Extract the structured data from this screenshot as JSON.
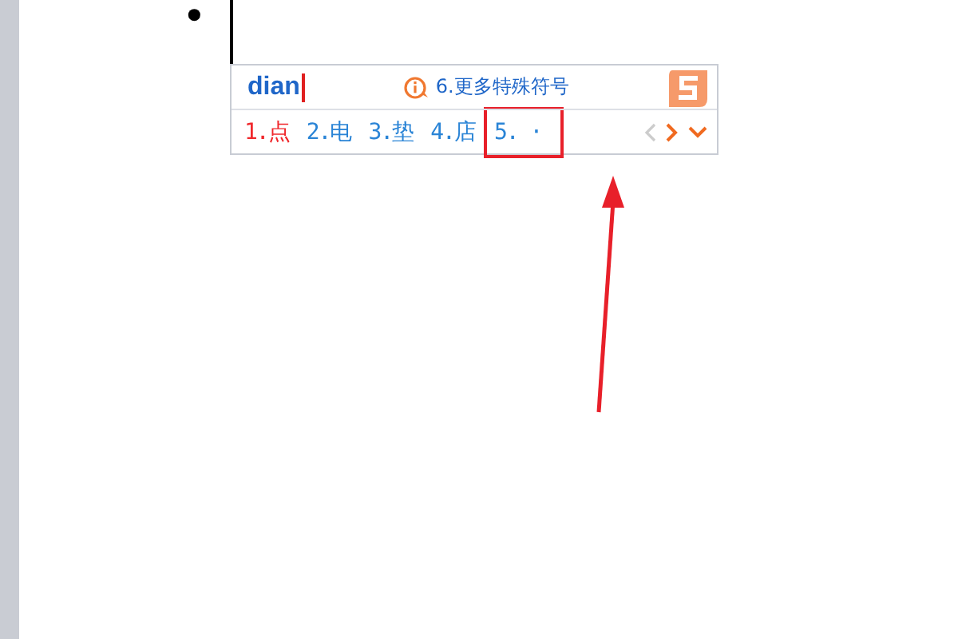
{
  "document": {
    "bullet": "•"
  },
  "ime": {
    "composition": "dian",
    "hint": "6.更多特殊符号",
    "candidates": [
      {
        "label": "1.点",
        "selected": true,
        "highlighted": false
      },
      {
        "label": "2.电",
        "selected": false,
        "highlighted": false
      },
      {
        "label": "3.垫",
        "selected": false,
        "highlighted": false
      },
      {
        "label": "4.店",
        "selected": false,
        "highlighted": false
      },
      {
        "label": "5. ·",
        "selected": false,
        "highlighted": true
      }
    ],
    "prev_page": {
      "disabled": true
    },
    "next_page": {
      "disabled": false
    }
  },
  "annotation": {
    "kind": "arrow"
  }
}
